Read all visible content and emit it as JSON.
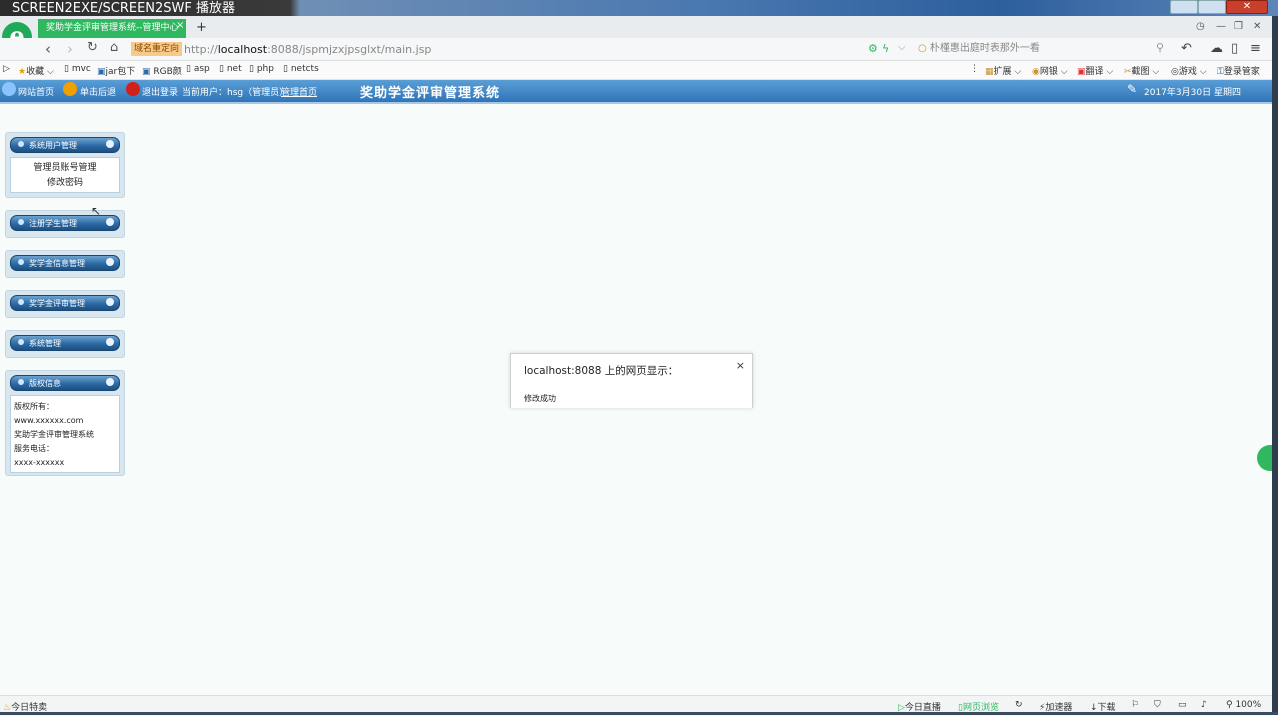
{
  "player": {
    "title": "SCREEN2EXE/SCREEN2SWF 播放器"
  },
  "browser": {
    "tab_title": "奖助学金评审管理系统--管理中心",
    "tab_close": "×",
    "new_tab": "+",
    "redirect_badge": "域名重定向",
    "url_prefix": "http://",
    "url_host": "localhost",
    "url_rest": ":8088/jspmjzxjpsglxt/main.jsp",
    "search_text": "朴槿惠出庭时表那外一看",
    "bookmarks": [
      "收藏",
      "mvc",
      "jar包下",
      "RGB颜",
      "asp",
      "net",
      "php",
      "netcts"
    ],
    "right_tools": [
      "扩展",
      "网银",
      "翻译",
      "截图",
      "游戏",
      "登录管家"
    ],
    "status_left": "今日特卖",
    "status_right": [
      "今日直播",
      "网页浏览",
      "加速器",
      "下载",
      "100%"
    ]
  },
  "header": {
    "home_link": "网站首页",
    "back_link": "单击后退",
    "logout_link": "退出登录",
    "current_user": "当前用户：hsg（管理员）",
    "admin_home": "管理首页",
    "site_title": "奖助学金评审管理系统",
    "date": "2017年3月30日 星期四"
  },
  "sidebar": {
    "panels": [
      {
        "title": "系统用户管理",
        "items": [
          "管理员账号管理",
          "修改密码"
        ]
      },
      {
        "title": "注册学生管理"
      },
      {
        "title": "奖学金信息管理"
      },
      {
        "title": "奖学金评审管理"
      },
      {
        "title": "系统管理"
      },
      {
        "title": "版权信息",
        "info": [
          "版权所有：",
          "www.xxxxxx.com",
          "奖助学金评审管理系统",
          "服务电话：",
          "xxxx-xxxxxx"
        ]
      }
    ]
  },
  "dialog": {
    "title": "localhost:8088 上的网页显示：",
    "close": "×",
    "message": "修改成功"
  }
}
